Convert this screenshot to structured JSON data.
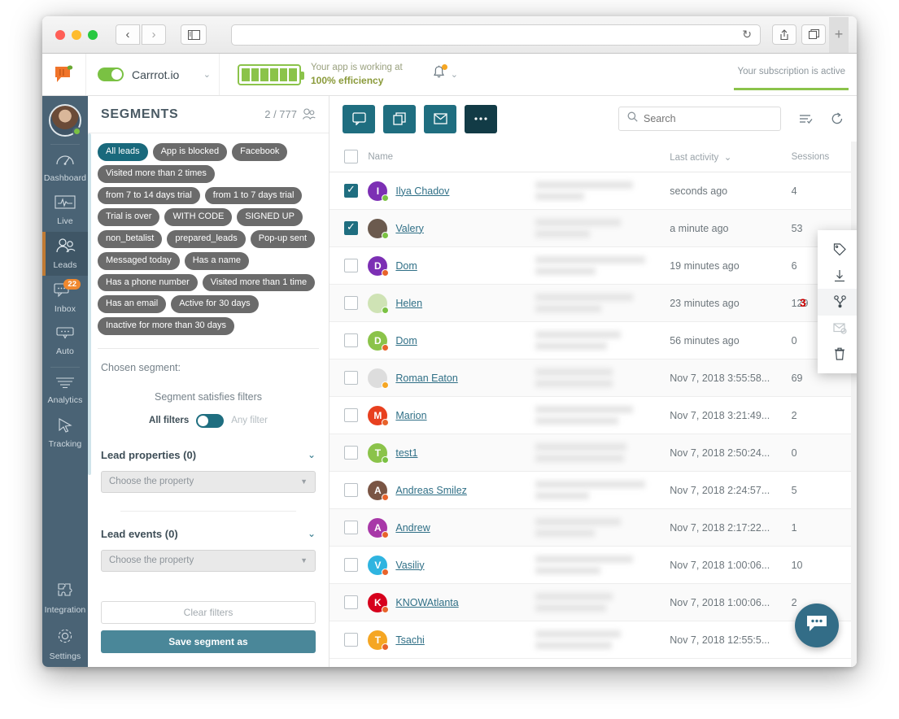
{
  "browser": {
    "back_icon": "chevron-left-icon",
    "forward_icon": "chevron-right-icon",
    "sidebar_icon": "sidebar-toggle-icon",
    "url_value": "",
    "url_placeholder": "",
    "reload_icon": "reload-icon",
    "share_icon": "share-icon",
    "tabs_icon": "tabs-icon",
    "new_tab_label": "+"
  },
  "app_header": {
    "logo": "carrot-logo-icon",
    "site_toggle_on": true,
    "site_name": "Carrrot.io",
    "site_chevron": "chevron-down-icon",
    "battery_segments": 6,
    "efficiency_line1": "Your app is working at",
    "efficiency_line2": "100% efficiency",
    "bell_icon": "bell-icon",
    "bell_has_alert": true,
    "bell_chevron": "chevron-down-icon",
    "subscription_text": "Your subscription is active",
    "accent_green": "#8bc34a"
  },
  "rail": {
    "avatar": "user-avatar",
    "items": [
      {
        "label": "Dashboard",
        "icon": "speedometer-icon",
        "active": false,
        "badge": ""
      },
      {
        "label": "Live",
        "icon": "pulse-icon",
        "active": false,
        "badge": ""
      },
      {
        "label": "Leads",
        "icon": "people-icon",
        "active": true,
        "badge": ""
      },
      {
        "label": "Inbox",
        "icon": "chat-icon",
        "active": false,
        "badge": "22"
      },
      {
        "label": "Auto",
        "icon": "auto-message-icon",
        "active": false,
        "badge": ""
      },
      {
        "label": "Analytics",
        "icon": "analytics-icon",
        "active": false,
        "badge": ""
      },
      {
        "label": "Tracking",
        "icon": "cursor-icon",
        "active": false,
        "badge": ""
      }
    ],
    "bottom_items": [
      {
        "label": "Integration",
        "icon": "puzzle-icon"
      },
      {
        "label": "Settings",
        "icon": "gear-icon"
      }
    ]
  },
  "segments": {
    "title": "SEGMENTS",
    "count": "2 / 777",
    "people_icon": "people-icon",
    "tags": [
      {
        "label": "All leads",
        "selected": true
      },
      {
        "label": "App is blocked",
        "selected": false
      },
      {
        "label": "Facebook",
        "selected": false
      },
      {
        "label": "Visited more than 2 times",
        "selected": false
      },
      {
        "label": "from 7 to 14 days trial",
        "selected": false
      },
      {
        "label": "from 1 to 7 days trial",
        "selected": false
      },
      {
        "label": "Trial is over",
        "selected": false
      },
      {
        "label": "WITH CODE",
        "selected": false
      },
      {
        "label": "SIGNED UP",
        "selected": false
      },
      {
        "label": "non_betalist",
        "selected": false
      },
      {
        "label": "prepared_leads",
        "selected": false
      },
      {
        "label": "Pop-up sent",
        "selected": false
      },
      {
        "label": "Messaged today",
        "selected": false
      },
      {
        "label": "Has a name",
        "selected": false
      },
      {
        "label": "Has a phone number",
        "selected": false
      },
      {
        "label": "Visited more than 1 time",
        "selected": false
      },
      {
        "label": "Has an email",
        "selected": false
      },
      {
        "label": "Active for 30 days",
        "selected": false
      },
      {
        "label": "Inactive for more than 30 days",
        "selected": false
      }
    ],
    "chosen_label": "Chosen segment:",
    "satisfies_label": "Segment satisfies filters",
    "all_filters_label": "All filters",
    "any_filter_label": "Any filter",
    "lead_properties_title": "Lead properties (0)",
    "lead_properties_placeholder": "Choose the property",
    "lead_events_title": "Lead events (0)",
    "lead_events_placeholder": "Choose the property",
    "clear_filters_label": "Clear filters",
    "save_segment_label": "Save segment as"
  },
  "toolbar": {
    "buttons": [
      {
        "icon": "message-icon",
        "name": "send-message-button",
        "dark": false
      },
      {
        "icon": "copy-icon",
        "name": "copy-button",
        "dark": false
      },
      {
        "icon": "envelope-icon",
        "name": "send-email-button",
        "dark": false
      },
      {
        "icon": "ellipsis-icon",
        "name": "more-actions-button",
        "dark": true
      }
    ],
    "search_placeholder": "Search",
    "search_value": "",
    "search_icon": "search-icon",
    "filter_icon": "filter-sort-icon",
    "refresh_icon": "refresh-icon"
  },
  "menu": {
    "annotation_number": "3",
    "items": [
      {
        "label": "Add tags to the lead",
        "icon": "tag-icon",
        "disabled": false,
        "highlighted": false
      },
      {
        "label": "Export leads",
        "icon": "download-icon",
        "disabled": false,
        "highlighted": false
      },
      {
        "label": "Merge two leads",
        "icon": "merge-icon",
        "disabled": false,
        "highlighted": true
      },
      {
        "label": "Send email subscription confirmation",
        "icon": "email-confirm-icon",
        "disabled": true,
        "highlighted": false
      },
      {
        "label": "Hide leads",
        "icon": "trash-icon",
        "disabled": false,
        "highlighted": false
      }
    ]
  },
  "table": {
    "columns": [
      "",
      "Name",
      "",
      "Last activity",
      "Sessions"
    ],
    "activity_sort_icon": "chevron-down-icon",
    "rows": [
      {
        "checked": true,
        "name": "Ilya Chadov",
        "initial": "I",
        "color": "#7c2fb4",
        "status": "on",
        "activity": "seconds ago",
        "sessions": "4",
        "blur": "w1"
      },
      {
        "checked": true,
        "name": "Valery",
        "initial": "",
        "color": "#6b5a4e",
        "status": "on",
        "activity": "a minute ago",
        "sessions": "53",
        "blur": "w2"
      },
      {
        "checked": false,
        "name": "Dom",
        "initial": "D",
        "color": "#7c2fb4",
        "status": "off",
        "activity": "19 minutes ago",
        "sessions": "6",
        "blur": "w3"
      },
      {
        "checked": false,
        "name": "Helen",
        "initial": "",
        "color": "#cfe3b5",
        "status": "on",
        "activity": "23 minutes ago",
        "sessions": "129",
        "blur": "w1"
      },
      {
        "checked": false,
        "name": "Dom",
        "initial": "D",
        "color": "#8bc34a",
        "status": "off",
        "activity": "56 minutes ago",
        "sessions": "0",
        "blur": "w2"
      },
      {
        "checked": false,
        "name": "Roman Eaton",
        "initial": "",
        "color": "#dddddd",
        "status": "away",
        "activity": "Nov 7, 2018 3:55:58...",
        "sessions": "69",
        "blur": "w4"
      },
      {
        "checked": false,
        "name": "Marion",
        "initial": "M",
        "color": "#e8401f",
        "status": "off",
        "activity": "Nov 7, 2018 3:21:49...",
        "sessions": "2",
        "blur": "w1"
      },
      {
        "checked": false,
        "name": "test1",
        "initial": "T",
        "color": "#8bc34a",
        "status": "on",
        "activity": "Nov 7, 2018 2:50:24...",
        "sessions": "0",
        "blur": "w5"
      },
      {
        "checked": false,
        "name": "Andreas Smilez",
        "initial": "A",
        "color": "#7a5544",
        "status": "off",
        "activity": "Nov 7, 2018 2:24:57...",
        "sessions": "5",
        "blur": "w3"
      },
      {
        "checked": false,
        "name": "Andrew",
        "initial": "A",
        "color": "#a838a8",
        "status": "off",
        "activity": "Nov 7, 2018 2:17:22...",
        "sessions": "1",
        "blur": "w2"
      },
      {
        "checked": false,
        "name": "Vasiliy",
        "initial": "V",
        "color": "#2fb4e0",
        "status": "off",
        "activity": "Nov 7, 2018 1:00:06...",
        "sessions": "10",
        "blur": "w1"
      },
      {
        "checked": false,
        "name": "KNOWAtlanta",
        "initial": "K",
        "color": "#d6001c",
        "status": "off",
        "activity": "Nov 7, 2018 1:00:06...",
        "sessions": "2",
        "blur": "w4"
      },
      {
        "checked": false,
        "name": "Tsachi",
        "initial": "T",
        "color": "#f5a623",
        "status": "off",
        "activity": "Nov 7, 2018 12:55:5...",
        "sessions": "",
        "blur": "w2"
      }
    ]
  },
  "chat_fab": {
    "icon": "chat-bubble-icon",
    "color": "#336d87"
  }
}
